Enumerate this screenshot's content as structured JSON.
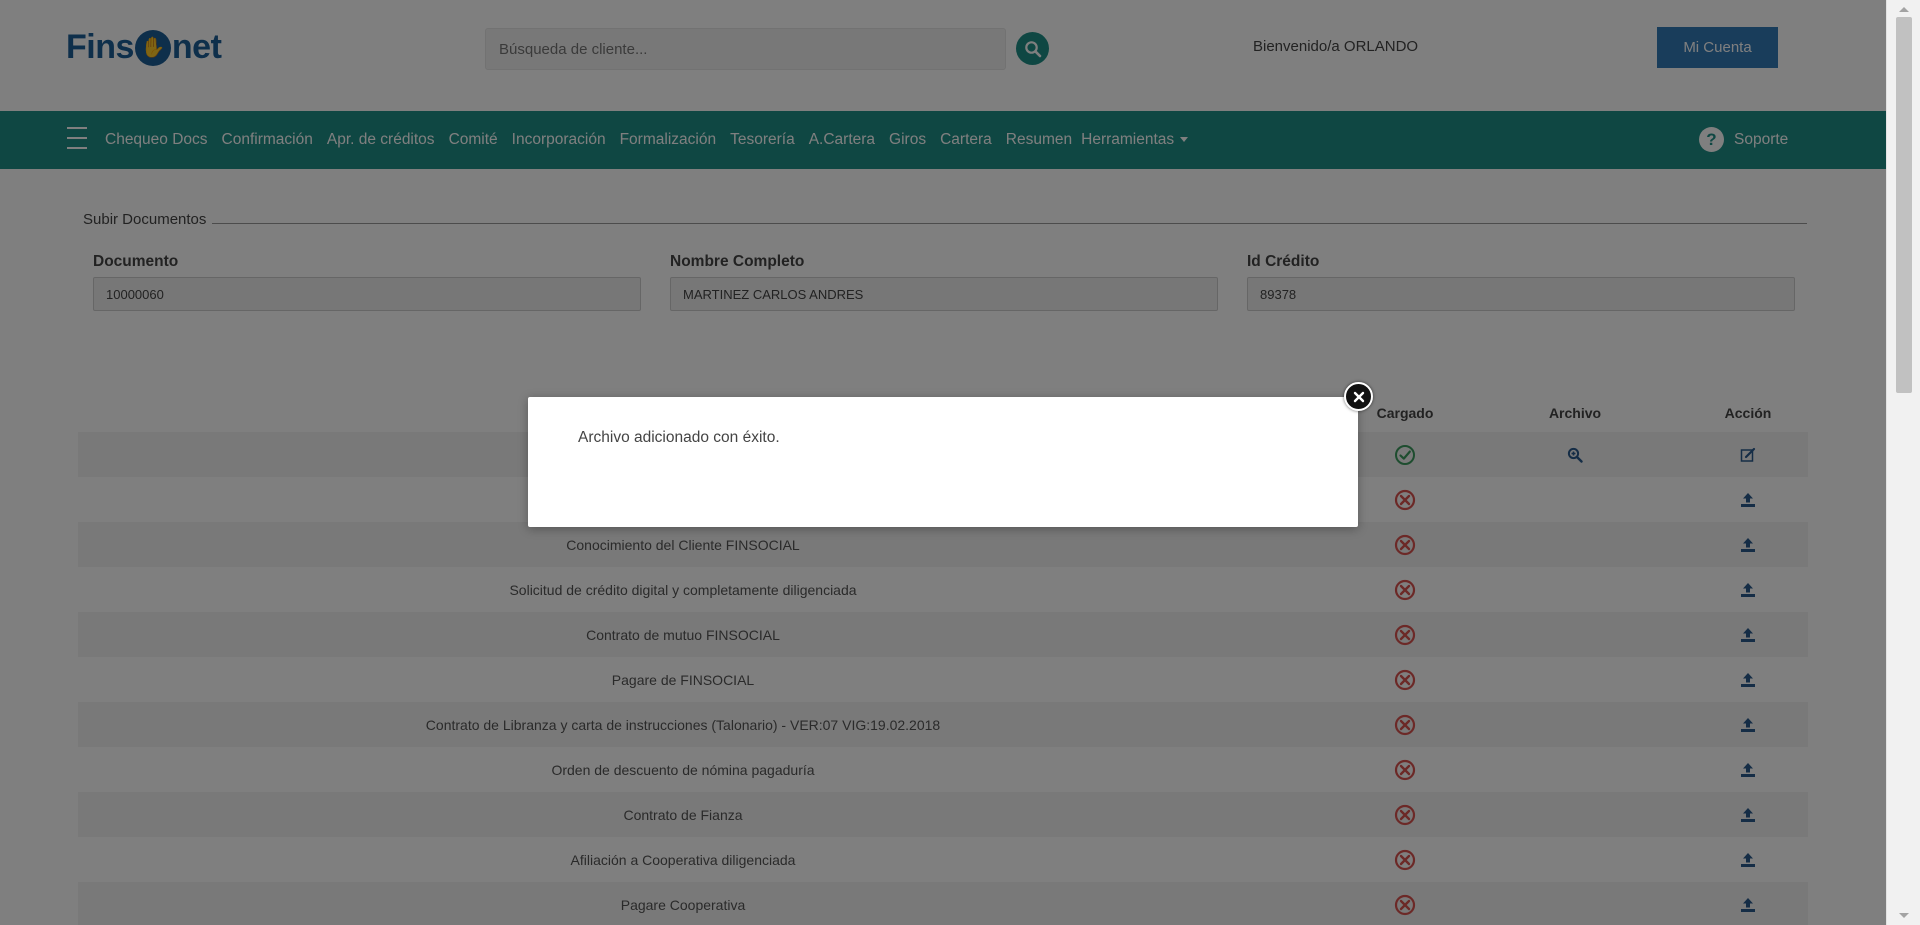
{
  "header": {
    "logo_left": "Fins",
    "logo_right": "net",
    "search_placeholder": "Búsqueda de cliente...",
    "welcome": "Bienvenido/a ORLANDO",
    "account_button": "Mi Cuenta"
  },
  "nav": {
    "items": [
      "Chequeo Docs",
      "Confirmación",
      "Apr. de créditos",
      "Comité",
      "Incorporación",
      "Formalización",
      "Tesorería",
      "A.Cartera",
      "Giros",
      "Cartera",
      "Resumen"
    ],
    "dropdown_label": "Herramientas",
    "support_label": "Soporte",
    "support_glyph": "?"
  },
  "form": {
    "legend": "Subir Documentos",
    "documento_label": "Documento",
    "documento_value": "10000060",
    "nombre_label": "Nombre Completo",
    "nombre_value": "MARTINEZ CARLOS ANDRES",
    "credito_label": "Id Crédito",
    "credito_value": "89378"
  },
  "table": {
    "headers": {
      "cargado": "Cargado",
      "archivo": "Archivo",
      "accion": "Acción"
    },
    "rows": [
      {
        "name": "",
        "loaded": true,
        "status_icon": "check-circle-icon",
        "file_icon": "zoom-icon",
        "action_icon": "edit-icon"
      },
      {
        "name": "",
        "loaded": false,
        "status_icon": "x-circle-icon",
        "action_icon": "upload-icon"
      },
      {
        "name": "Conocimiento del Cliente FINSOCIAL",
        "loaded": false,
        "status_icon": "x-circle-icon",
        "action_icon": "upload-icon"
      },
      {
        "name": "Solicitud de crédito digital y completamente diligenciada",
        "loaded": false,
        "status_icon": "x-circle-icon",
        "action_icon": "upload-icon"
      },
      {
        "name": "Contrato de mutuo FINSOCIAL",
        "loaded": false,
        "status_icon": "x-circle-icon",
        "action_icon": "upload-icon"
      },
      {
        "name": "Pagare de FINSOCIAL",
        "loaded": false,
        "status_icon": "x-circle-icon",
        "action_icon": "upload-icon"
      },
      {
        "name": "Contrato de Libranza y carta de instrucciones (Talonario) - VER:07 VIG:19.02.2018",
        "loaded": false,
        "status_icon": "x-circle-icon",
        "action_icon": "upload-icon"
      },
      {
        "name": "Orden de descuento de nómina pagaduría",
        "loaded": false,
        "status_icon": "x-circle-icon",
        "action_icon": "upload-icon"
      },
      {
        "name": "Contrato de Fianza",
        "loaded": false,
        "status_icon": "x-circle-icon",
        "action_icon": "upload-icon"
      },
      {
        "name": "Afiliación a Cooperativa diligenciada",
        "loaded": false,
        "status_icon": "x-circle-icon",
        "action_icon": "upload-icon"
      },
      {
        "name": "Pagare Cooperativa",
        "loaded": false,
        "status_icon": "x-circle-icon",
        "action_icon": "upload-icon"
      }
    ]
  },
  "modal": {
    "message": "Archivo adicionado con éxito."
  },
  "colors": {
    "brand_blue": "#1d5e96",
    "nav_teal": "#1f8f87",
    "button_blue": "#337ab7",
    "error_red": "#d9534f",
    "success_green": "#3c9a5f"
  }
}
